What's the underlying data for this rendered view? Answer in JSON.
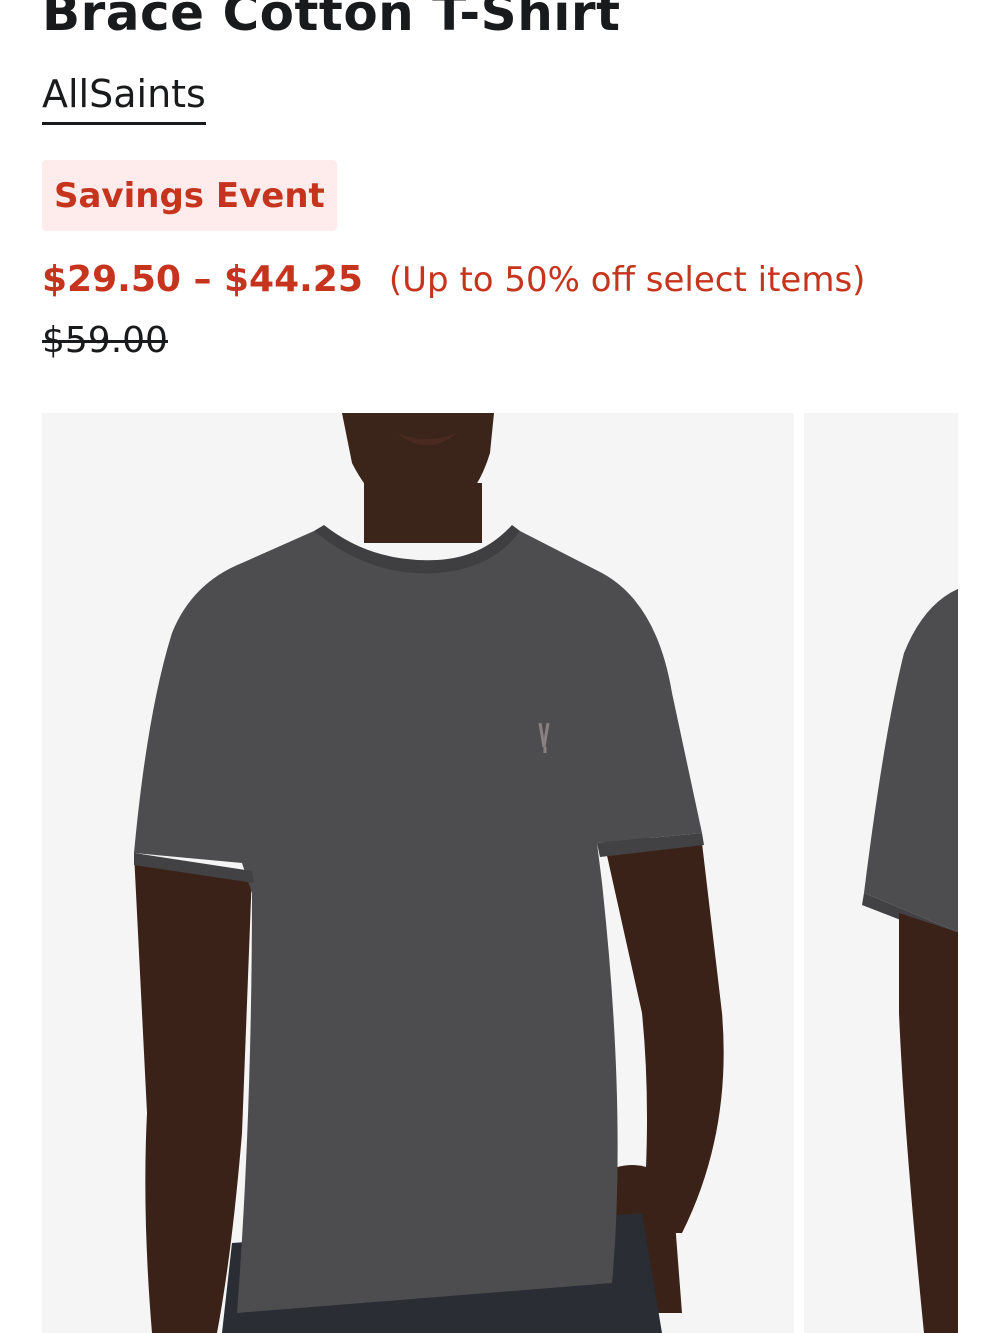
{
  "product": {
    "title": "Brace Cotton T-Shirt",
    "brand": "AllSaints"
  },
  "promo": {
    "badge": "Savings Event"
  },
  "pricing": {
    "sale_range": "$29.50 – $44.25",
    "note": "(Up to 50% off select items)",
    "original": "$59.00"
  },
  "gallery": {
    "images": [
      {
        "subject": "model-front-grey-tshirt"
      },
      {
        "subject": "model-side-grey-tshirt"
      }
    ]
  },
  "colors": {
    "sale_red": "#c6341d",
    "badge_bg": "#fdeceb",
    "text_dark": "#191a1b",
    "image_bg": "#f5f5f5",
    "shirt_grey": "#4d4d4f"
  }
}
